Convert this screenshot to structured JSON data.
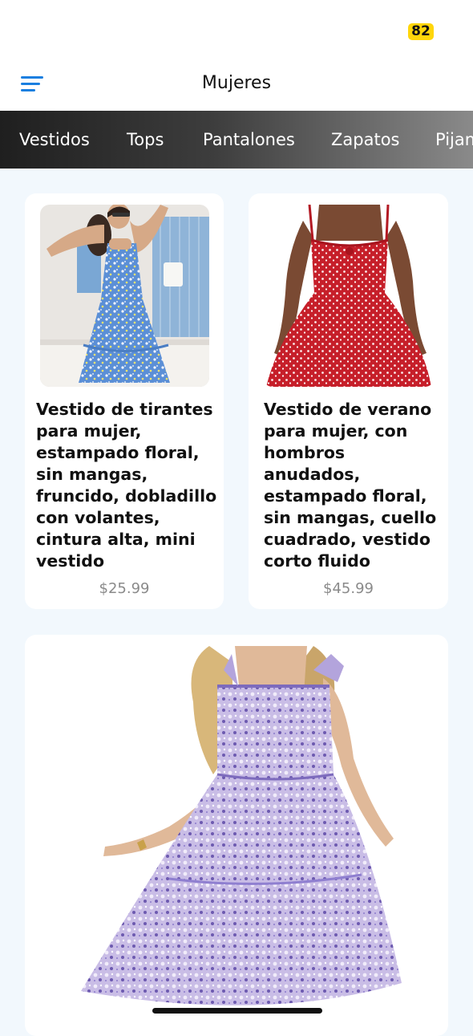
{
  "status_bar": {
    "battery": "82"
  },
  "header": {
    "title": "Mujeres"
  },
  "categories": [
    "Vestidos",
    "Tops",
    "Pantalones",
    "Zapatos",
    "Pijamas"
  ],
  "products": [
    {
      "title": "Vestido de tirantes para mujer, estampado floral, sin mangas, fruncido, dobladillo con volantes, cintura alta, mini vestido",
      "price": "$25.99",
      "image": "woman-blue-floral-dress-photo"
    },
    {
      "title": "Vestido de verano para mujer, con hombros anudados, estampado floral, sin mangas, cuello cuadrado, vestido corto fluido",
      "price": "$45.99",
      "image": "red-floral-dress-photo"
    },
    {
      "image": "lavender-floral-dress-photo"
    }
  ],
  "colors": {
    "accent": "#1a7fe0",
    "battery": "#ffd60a",
    "background": "#f2f8fd"
  }
}
